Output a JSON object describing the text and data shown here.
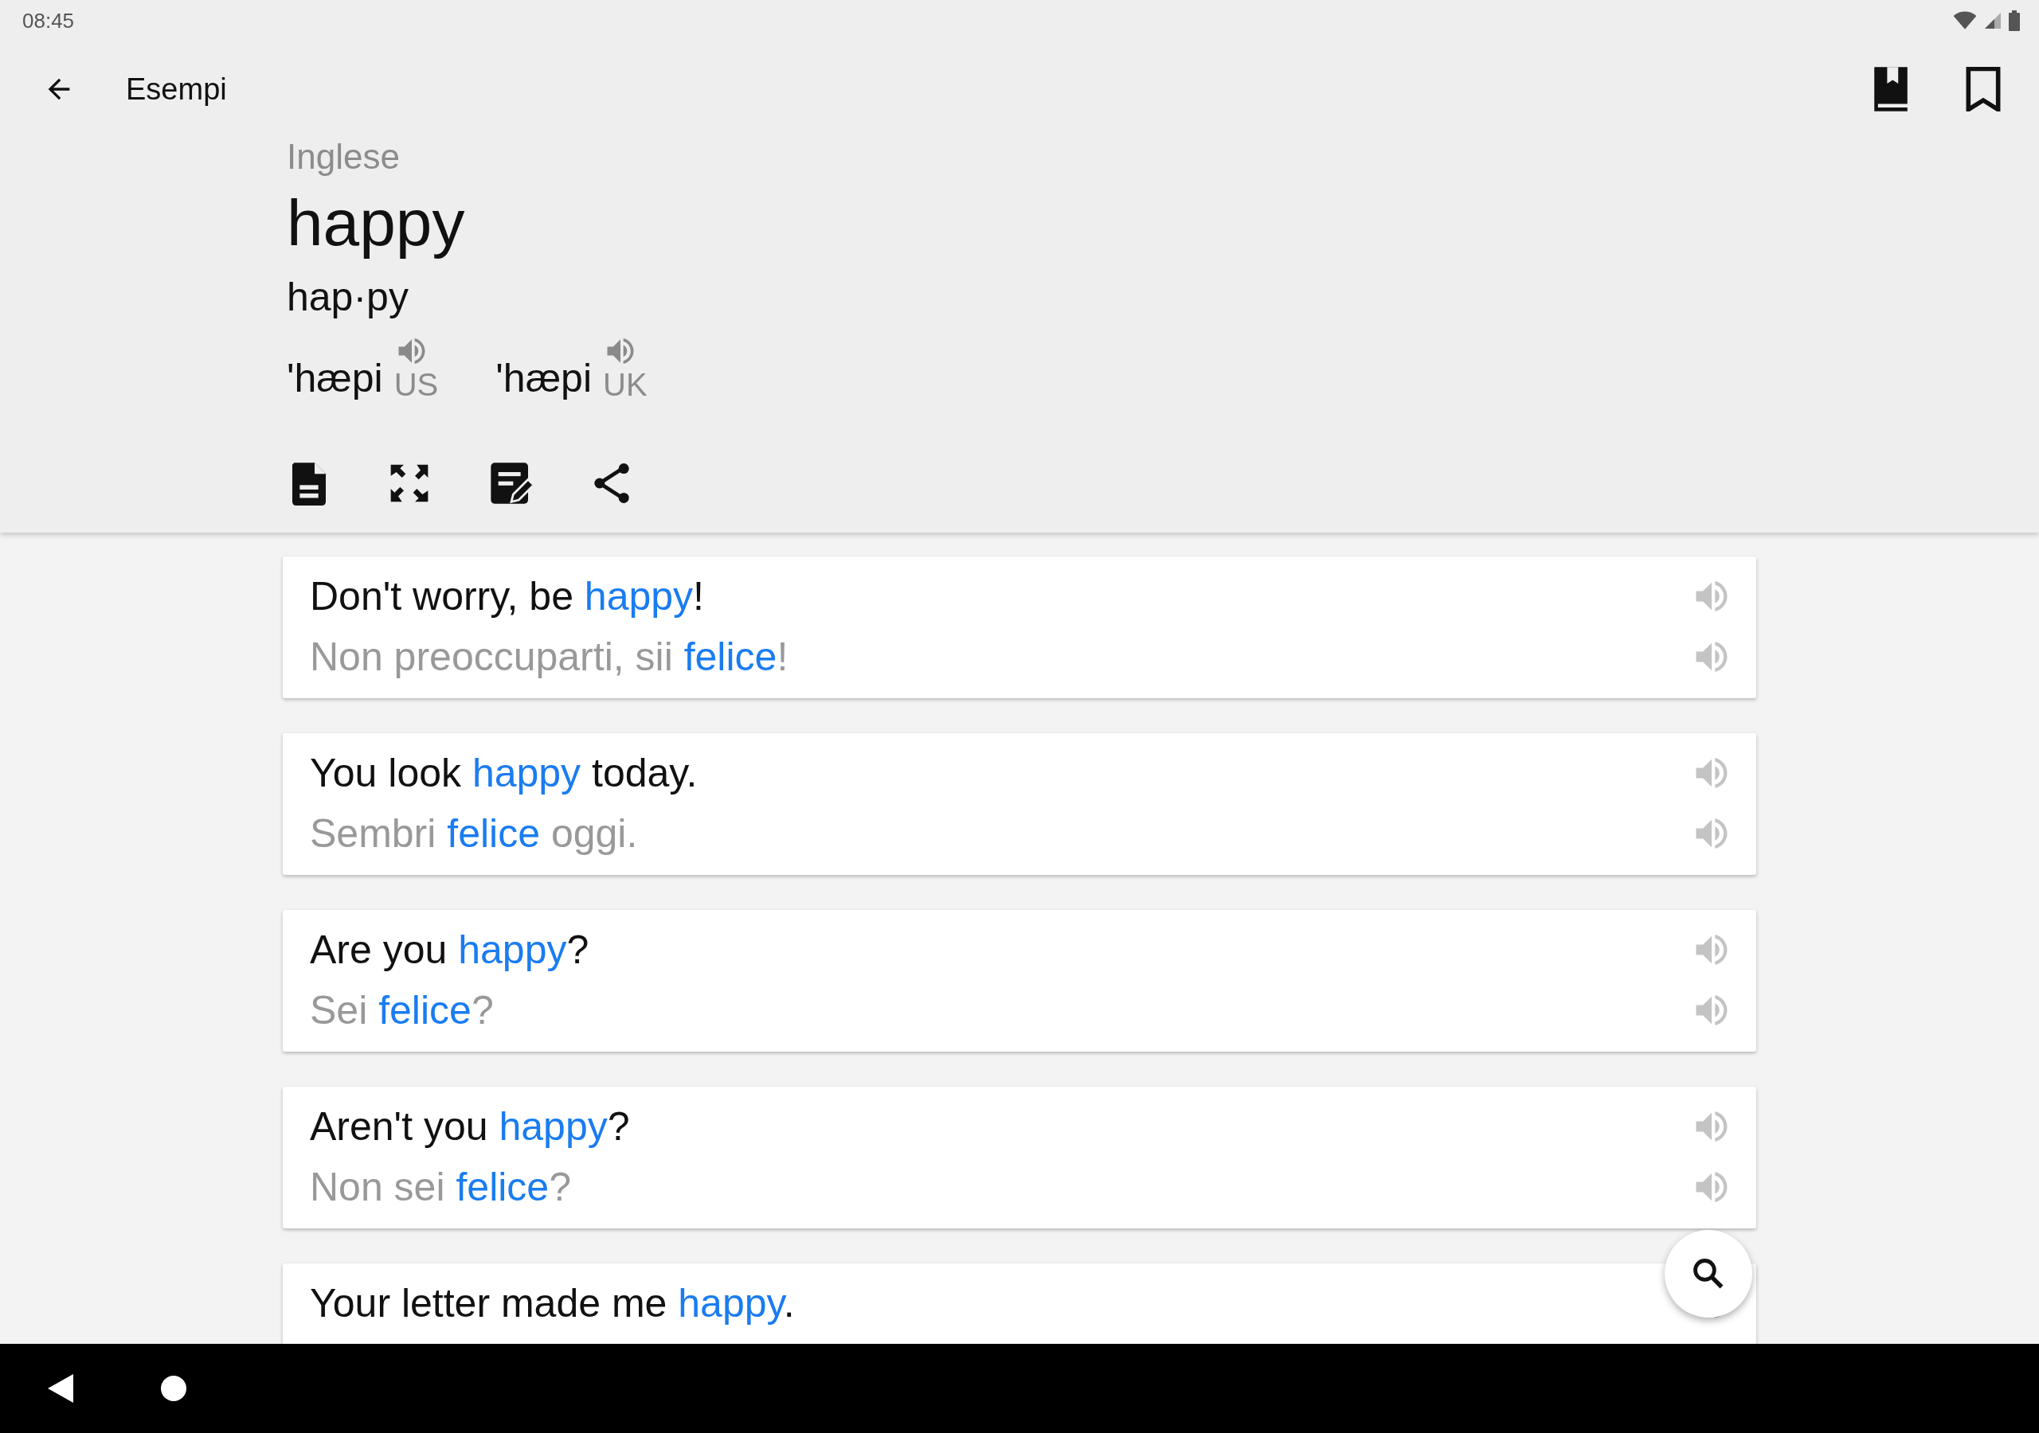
{
  "status_bar": {
    "time": "08:45"
  },
  "toolbar": {
    "title": "Esempi"
  },
  "entry": {
    "language": "Inglese",
    "word": "happy",
    "syllables": "hap·py",
    "pronunciations": [
      {
        "ipa": "'hæpi",
        "region": "US"
      },
      {
        "ipa": "'hæpi",
        "region": "UK"
      }
    ]
  },
  "examples": [
    {
      "source": [
        {
          "text": "Don't worry, be ",
          "highlight": false
        },
        {
          "text": "happy",
          "highlight": true
        },
        {
          "text": "!",
          "highlight": false
        }
      ],
      "translation": [
        {
          "text": "Non preoccuparti, sii ",
          "highlight": false
        },
        {
          "text": "felice",
          "highlight": true
        },
        {
          "text": "!",
          "highlight": false
        }
      ]
    },
    {
      "source": [
        {
          "text": "You look ",
          "highlight": false
        },
        {
          "text": "happy",
          "highlight": true
        },
        {
          "text": " today.",
          "highlight": false
        }
      ],
      "translation": [
        {
          "text": "Sembri ",
          "highlight": false
        },
        {
          "text": "felice",
          "highlight": true
        },
        {
          "text": " oggi.",
          "highlight": false
        }
      ]
    },
    {
      "source": [
        {
          "text": "Are you ",
          "highlight": false
        },
        {
          "text": "happy",
          "highlight": true
        },
        {
          "text": "?",
          "highlight": false
        }
      ],
      "translation": [
        {
          "text": "Sei ",
          "highlight": false
        },
        {
          "text": "felice",
          "highlight": true
        },
        {
          "text": "?",
          "highlight": false
        }
      ]
    },
    {
      "source": [
        {
          "text": "Aren't you ",
          "highlight": false
        },
        {
          "text": "happy",
          "highlight": true
        },
        {
          "text": "?",
          "highlight": false
        }
      ],
      "translation": [
        {
          "text": "Non sei ",
          "highlight": false
        },
        {
          "text": "felice",
          "highlight": true
        },
        {
          "text": "?",
          "highlight": false
        }
      ]
    },
    {
      "source": [
        {
          "text": "Your letter made me ",
          "highlight": false
        },
        {
          "text": "happy",
          "highlight": true
        },
        {
          "text": ".",
          "highlight": false
        }
      ]
    }
  ]
}
